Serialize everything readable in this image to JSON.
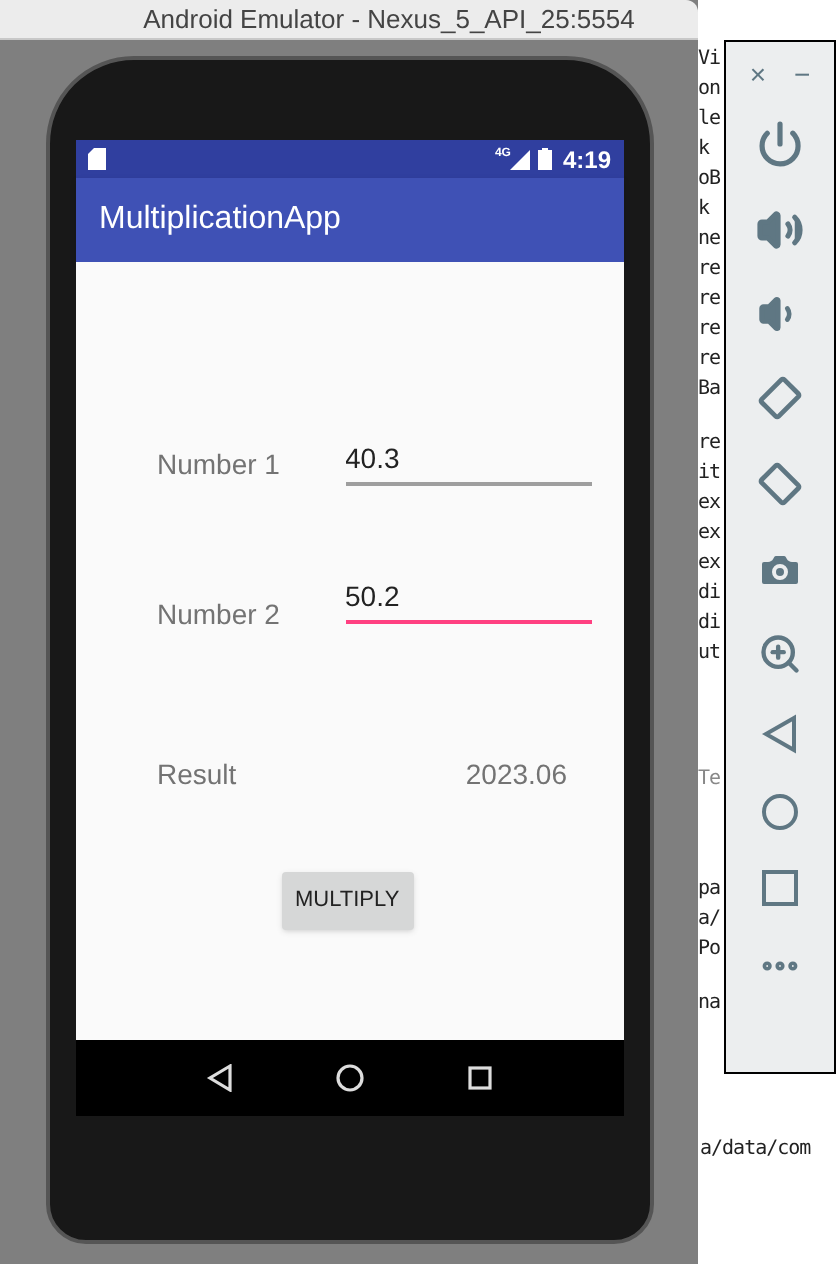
{
  "window": {
    "title": "Android Emulator - Nexus_5_API_25:5554"
  },
  "status_bar": {
    "network": "4G",
    "time": "4:19"
  },
  "app_bar": {
    "title": "MultiplicationApp"
  },
  "fields": [
    {
      "label": "Number 1",
      "value": "40.3",
      "focused": false
    },
    {
      "label": "Number 2",
      "value": "50.2",
      "focused": true
    }
  ],
  "result": {
    "label": "Result",
    "value": "2023.06"
  },
  "button": "MULTIPLY",
  "emulator_panel": {
    "close": "×",
    "minimize": "−"
  },
  "ide_background": {
    "upper_lines": [
      "Vi",
      "on",
      "le",
      "k",
      "oB",
      "k",
      "ne",
      "re",
      "re",
      "re",
      "re",
      "Ba"
    ],
    "middle_lines": [
      "re",
      "it",
      "ex",
      "ex",
      "ex",
      "di",
      "di",
      "ut"
    ],
    "tab_line": "Te",
    "lower_lines": [
      "pa",
      "a/",
      "Po"
    ],
    "last_line": "na",
    "path_line": "a/data/com"
  }
}
